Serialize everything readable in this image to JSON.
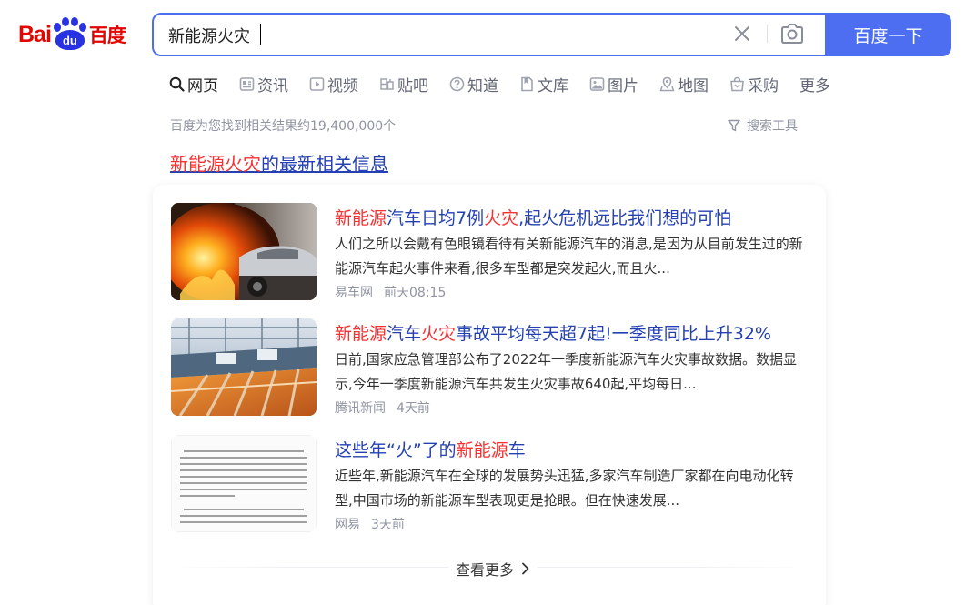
{
  "logo": {
    "left": "Bai",
    "paw": "du",
    "right": "百度"
  },
  "search": {
    "query": "新能源火灾",
    "button_label": "百度一下"
  },
  "tabs": [
    {
      "label": "网页",
      "icon": "search-icon"
    },
    {
      "label": "资讯",
      "icon": "news-icon"
    },
    {
      "label": "视频",
      "icon": "video-icon"
    },
    {
      "label": "贴吧",
      "icon": "tieba-icon"
    },
    {
      "label": "知道",
      "icon": "question-icon"
    },
    {
      "label": "文库",
      "icon": "document-icon"
    },
    {
      "label": "图片",
      "icon": "image-icon"
    },
    {
      "label": "地图",
      "icon": "map-icon"
    },
    {
      "label": "采购",
      "icon": "shopping-icon"
    },
    {
      "label": "更多",
      "icon": ""
    }
  ],
  "result_count": "百度为您找到相关结果约19,400,000个",
  "search_tools": "搜索工具",
  "news_block": {
    "title_highlight": "新能源火灾",
    "title_rest": "的最新相关信息",
    "items": [
      {
        "title_parts": [
          {
            "text": "新能源",
            "hl": true
          },
          {
            "text": "汽车日均7例",
            "hl": false
          },
          {
            "text": "火灾",
            "hl": true
          },
          {
            "text": ",起火危机远比我们想的可怕",
            "hl": false
          }
        ],
        "summary": "人们之所以会戴有色眼镜看待有关新能源汽车的消息,是因为从目前发生过的新能源汽车起火事件来看,很多车型都是突发起火,而且火...",
        "source": "易车网",
        "time": "前天08:15"
      },
      {
        "title_parts": [
          {
            "text": "新能源",
            "hl": true
          },
          {
            "text": "汽车",
            "hl": false
          },
          {
            "text": "火灾",
            "hl": true
          },
          {
            "text": "事故平均每天超7起!一季度同比上升32%",
            "hl": false
          }
        ],
        "summary": "日前,国家应急管理部公布了2022年一季度新能源汽车火灾事故数据。数据显示,今年一季度新能源汽车共发生火灾事故640起,平均每日...",
        "source": "腾讯新闻",
        "time": "4天前"
      },
      {
        "title_parts": [
          {
            "text": "这些年“火”了的",
            "hl": false
          },
          {
            "text": "新能源",
            "hl": true
          },
          {
            "text": "车",
            "hl": false
          }
        ],
        "summary": "近些年,新能源汽车在全球的发展势头迅猛,多家汽车制造厂家都在向电动化转型,中国市场的新能源车型表现更是抢眼。但在快速发展...",
        "source": "网易",
        "time": "3天前"
      }
    ],
    "see_more": "查看更多"
  },
  "colors": {
    "accent": "#4e6ef2",
    "highlight": "#f73131",
    "link": "#2440b3",
    "meta": "#9195a3"
  }
}
